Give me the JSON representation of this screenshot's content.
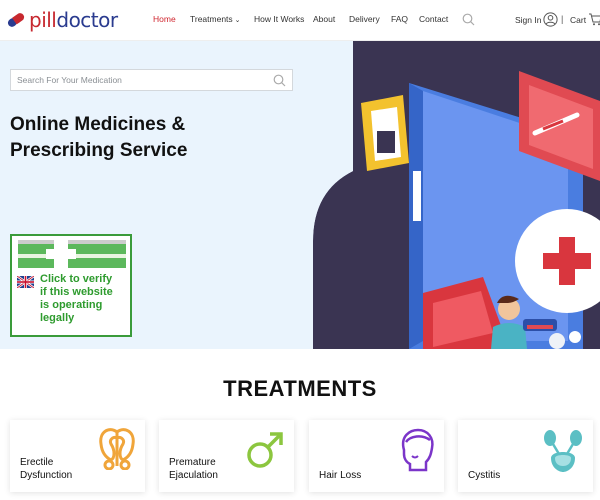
{
  "header": {
    "logo_text_1": "pill",
    "logo_text_2": "doctor",
    "nav": [
      {
        "label": "Home",
        "active": true
      },
      {
        "label": "Treatments",
        "active": false
      },
      {
        "label": "How It Works",
        "active": false
      },
      {
        "label": "About",
        "active": false
      },
      {
        "label": "Delivery",
        "active": false
      },
      {
        "label": "FAQ",
        "active": false
      },
      {
        "label": "Contact",
        "active": false
      }
    ],
    "signin_label": "Sign In",
    "separator": "|",
    "cart_label": "Cart",
    "dropdown_chevron": "⌄"
  },
  "hero": {
    "search_placeholder": "Search For Your Medication",
    "title_line1": "Online Medicines &",
    "title_line2": "Prescribing Service",
    "mhra_text_lines": [
      "Click to verify",
      "if this website",
      "is operating",
      "legally"
    ]
  },
  "treatments": {
    "title": "TREATMENTS",
    "cards": [
      {
        "line1": "Erectile",
        "line2": "Dysfunction",
        "icon": "kidney-icon"
      },
      {
        "line1": "Premature",
        "line2": "Ejaculation",
        "icon": "male-symbol-icon"
      },
      {
        "line1": "Hair Loss",
        "line2": "",
        "icon": "head-icon"
      },
      {
        "line1": "Cystitis",
        "line2": "",
        "icon": "bladder-icon"
      }
    ]
  },
  "colors": {
    "accent_red": "#d0262f",
    "brand_blue": "#2a3b8f",
    "hero_bg": "#eaf4fd",
    "mhra_green": "#3a9b3a",
    "icon_orange": "#f0a53a",
    "icon_green": "#8cc63f",
    "icon_purple": "#7b35c9",
    "icon_teal": "#5bbfc4"
  }
}
